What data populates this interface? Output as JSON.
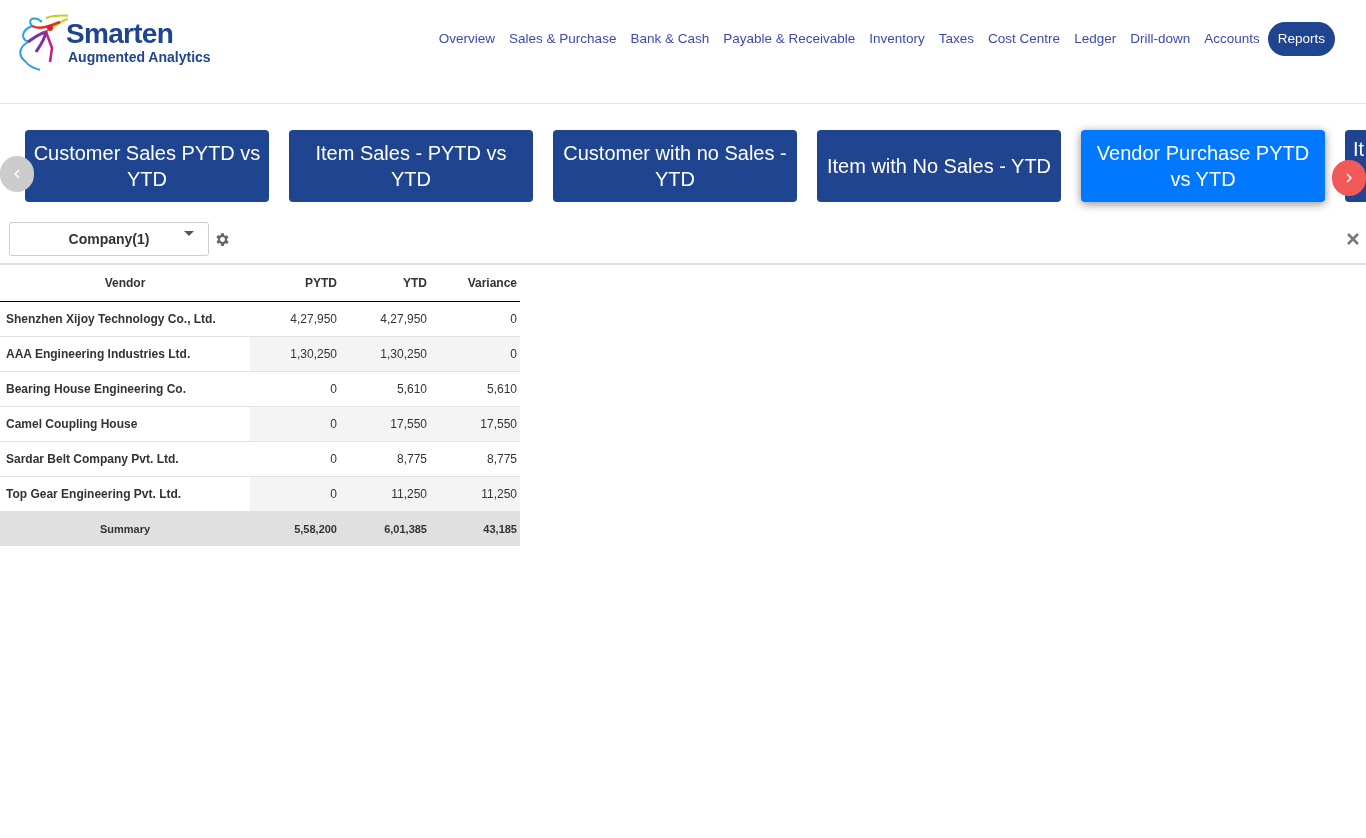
{
  "logo": {
    "name": "Smarten",
    "tagline": "Augmented Analytics"
  },
  "nav": [
    {
      "label": "Overview",
      "selected": false
    },
    {
      "label": "Sales & Purchase",
      "selected": false
    },
    {
      "label": "Bank & Cash",
      "selected": false
    },
    {
      "label": "Payable & Receivable",
      "selected": false
    },
    {
      "label": "Inventory",
      "selected": false
    },
    {
      "label": "Taxes",
      "selected": false
    },
    {
      "label": "Cost Centre",
      "selected": false
    },
    {
      "label": "Ledger",
      "selected": false
    },
    {
      "label": "Drill-down",
      "selected": false
    },
    {
      "label": "Accounts",
      "selected": false
    },
    {
      "label": "Reports",
      "selected": true
    }
  ],
  "report_cards": [
    {
      "label": "Customer Sales PYTD vs YTD",
      "selected": false
    },
    {
      "label": "Item Sales - PYTD vs YTD",
      "selected": false
    },
    {
      "label": "Customer with no Sales - YTD",
      "selected": false
    },
    {
      "label": "Item with No Sales - YTD",
      "selected": false
    },
    {
      "label": "Vendor Purchase PYTD vs YTD",
      "selected": true
    },
    {
      "label": "It",
      "selected": false
    }
  ],
  "filter": {
    "label": "Company(1)"
  },
  "table": {
    "columns": [
      "Vendor",
      "PYTD",
      "YTD",
      "Variance"
    ],
    "rows": [
      [
        "Shenzhen Xijoy Technology Co., Ltd.",
        "4,27,950",
        "4,27,950",
        "0"
      ],
      [
        "AAA Engineering Industries Ltd.",
        "1,30,250",
        "1,30,250",
        "0"
      ],
      [
        "Bearing House Engineering Co.",
        "0",
        "5,610",
        "5,610"
      ],
      [
        "Camel Coupling House",
        "0",
        "17,550",
        "17,550"
      ],
      [
        "Sardar Belt Company Pvt. Ltd.",
        "0",
        "8,775",
        "8,775"
      ],
      [
        "Top Gear Engineering Pvt. Ltd.",
        "0",
        "11,250",
        "11,250"
      ]
    ],
    "summary": [
      "Summary",
      "5,58,200",
      "6,01,385",
      "43,185"
    ]
  }
}
